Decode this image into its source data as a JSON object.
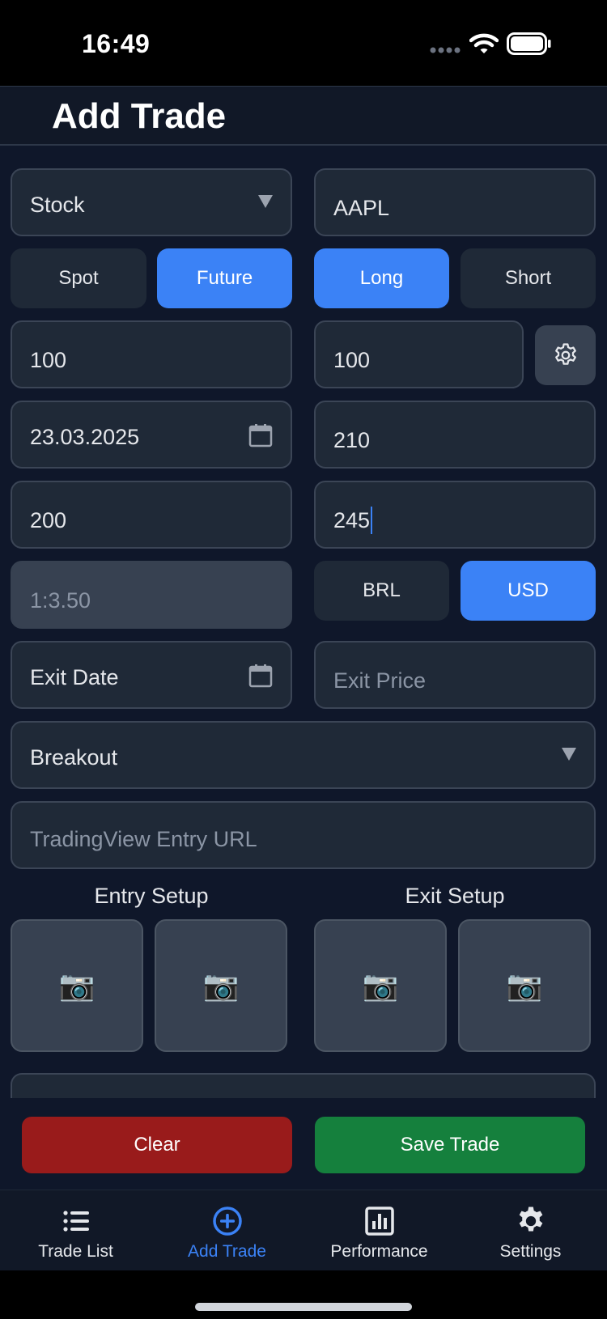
{
  "status_bar": {
    "time": "16:49"
  },
  "header": {
    "title": "Add Trade"
  },
  "form": {
    "asset_type": {
      "value": "Stock"
    },
    "symbol": {
      "value": "AAPL"
    },
    "market_toggle": {
      "options": [
        "Spot",
        "Future"
      ],
      "selected": "Future"
    },
    "direction_toggle": {
      "options": [
        "Long",
        "Short"
      ],
      "selected": "Long"
    },
    "quantity": {
      "value": "100"
    },
    "leverage": {
      "value": "100"
    },
    "entry_date": {
      "value": "23.03.2025"
    },
    "entry_price": {
      "value": "210"
    },
    "stop_loss": {
      "value": "200"
    },
    "take_profit": {
      "value": "245"
    },
    "risk_reward": {
      "value": "1:3.50"
    },
    "currency_toggle": {
      "options": [
        "BRL",
        "USD"
      ],
      "selected": "USD"
    },
    "exit_date": {
      "value": "Exit Date"
    },
    "exit_price": {
      "placeholder": "Exit Price"
    },
    "strategy": {
      "value": "Breakout"
    },
    "tradingview_url": {
      "placeholder": "TradingView Entry URL"
    },
    "entry_setup_label": "Entry Setup",
    "exit_setup_label": "Exit Setup",
    "camera_glyph": "📷"
  },
  "actions": {
    "clear_label": "Clear",
    "save_label": "Save Trade"
  },
  "tab_bar": {
    "items": [
      {
        "label": "Trade List",
        "icon": "list-icon"
      },
      {
        "label": "Add Trade",
        "icon": "plus-circle-icon"
      },
      {
        "label": "Performance",
        "icon": "chart-icon"
      },
      {
        "label": "Settings",
        "icon": "gear-icon"
      }
    ],
    "active": "Add Trade"
  },
  "colors": {
    "background": "#0f172a",
    "field": "#1f2937",
    "accent": "#3b82f6",
    "danger": "#991b1b",
    "success": "#15803d"
  }
}
